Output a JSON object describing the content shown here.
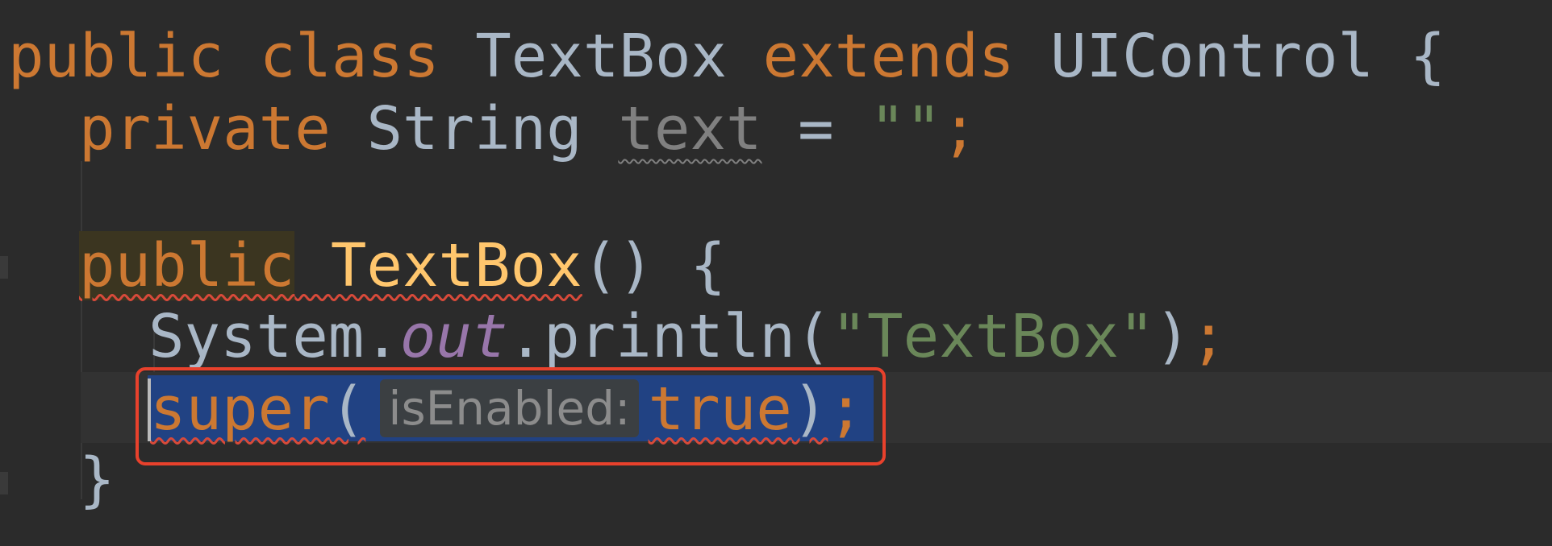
{
  "code": {
    "line1": {
      "kw_public": "public",
      "kw_class": "class",
      "class_name": "TextBox",
      "kw_extends": "extends",
      "parent_name": "UIControl",
      "brace": "{"
    },
    "line2": {
      "kw_private": "private",
      "type": "String",
      "field": "text",
      "eq": "=",
      "string_literal": "\"\"",
      "semi": ";"
    },
    "line4": {
      "kw_public": "public",
      "ctor_name": "TextBox",
      "parens": "()",
      "brace": "{"
    },
    "line5": {
      "system": "System.",
      "out": "out",
      "println": ".println(",
      "string_literal": "\"TextBox\"",
      "close": ")",
      "semi": ";"
    },
    "line6": {
      "kw_super": "super",
      "open": "(",
      "param_hint": "isEnabled:",
      "kw_true": "true",
      "close": ")",
      "semi": ";"
    },
    "line7": {
      "brace": "}"
    }
  },
  "colors": {
    "background": "#2b2b2b",
    "keyword": "#cc7832",
    "identifier": "#a9b7c6",
    "method": "#ffc66d",
    "string": "#6a8759",
    "selection": "#214283",
    "error_underline": "#d84a3a",
    "focus_box": "#e8412c"
  }
}
